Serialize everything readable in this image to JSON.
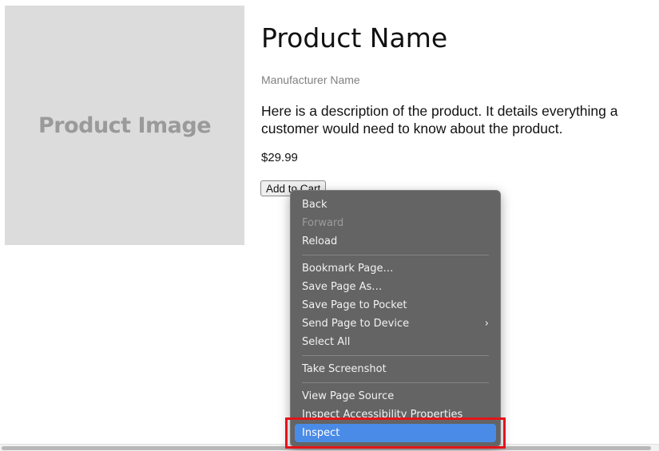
{
  "product": {
    "image_label": "Product Image",
    "name": "Product Name",
    "manufacturer": "Manufacturer Name",
    "description": "Here is a description of the product. It details everything a customer would need to know about the product.",
    "price": "$29.99",
    "add_to_cart": "Add to Cart"
  },
  "context_menu": {
    "groups": [
      [
        {
          "label": "Back",
          "disabled": false
        },
        {
          "label": "Forward",
          "disabled": true
        },
        {
          "label": "Reload",
          "disabled": false
        }
      ],
      [
        {
          "label": "Bookmark Page…"
        },
        {
          "label": "Save Page As…"
        },
        {
          "label": "Save Page to Pocket"
        },
        {
          "label": "Send Page to Device",
          "submenu_icon": "chevron-right-icon",
          "submenu_glyph": "›"
        },
        {
          "label": "Select All"
        }
      ],
      [
        {
          "label": "Take Screenshot"
        }
      ],
      [
        {
          "label": "View Page Source"
        },
        {
          "label": "Inspect Accessibility Properties"
        },
        {
          "label": "Inspect",
          "highlighted": true
        }
      ]
    ]
  },
  "colors": {
    "highlight": "#4a8be8",
    "annotation_box": "#e3141a",
    "menu_bg": "#646464"
  }
}
